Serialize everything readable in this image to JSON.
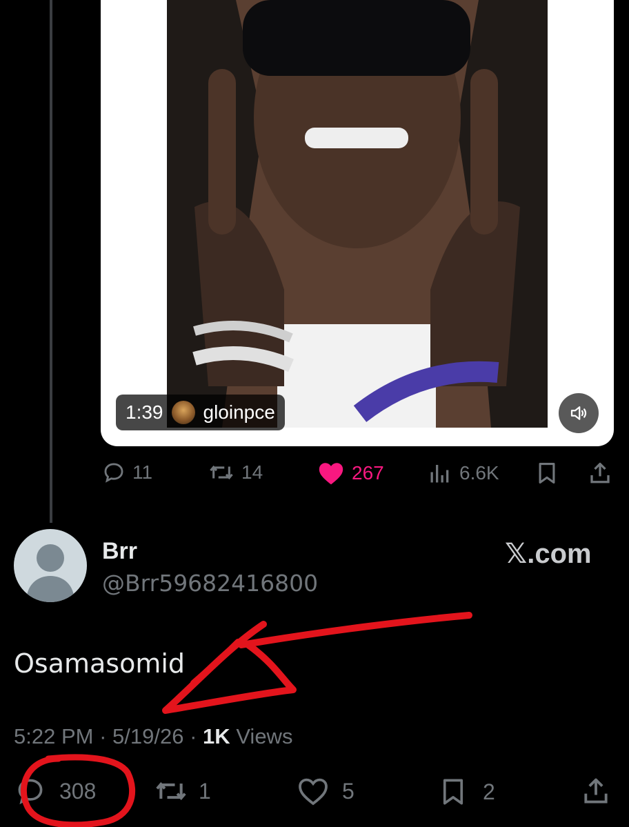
{
  "media": {
    "duration": "1:39",
    "channel_name": "gloinpce"
  },
  "quoted_actions": {
    "replies": "11",
    "reposts": "14",
    "likes": "267",
    "views": "6.6K"
  },
  "reply_post": {
    "display_name": "Brr",
    "handle": "@Brr59682416800",
    "watermark": "𝕏.com",
    "text": "Osamasomid",
    "time": "5:22 PM",
    "separator": "·",
    "date": "5/19/26",
    "views_count": "1K",
    "views_label": "Views"
  },
  "reply_actions": {
    "replies": "308",
    "reposts": "1",
    "likes": "5",
    "bookmarks": "2"
  },
  "colors": {
    "background": "#000000",
    "primary_text": "#e7e9ea",
    "secondary_text": "#71767b",
    "like_pink": "#f91880",
    "annotation_red": "#e3141c"
  },
  "icons": [
    "reply-icon",
    "repost-icon",
    "heart-icon",
    "views-icon",
    "bookmark-icon",
    "share-icon",
    "speaker-icon",
    "default-avatar-icon"
  ]
}
